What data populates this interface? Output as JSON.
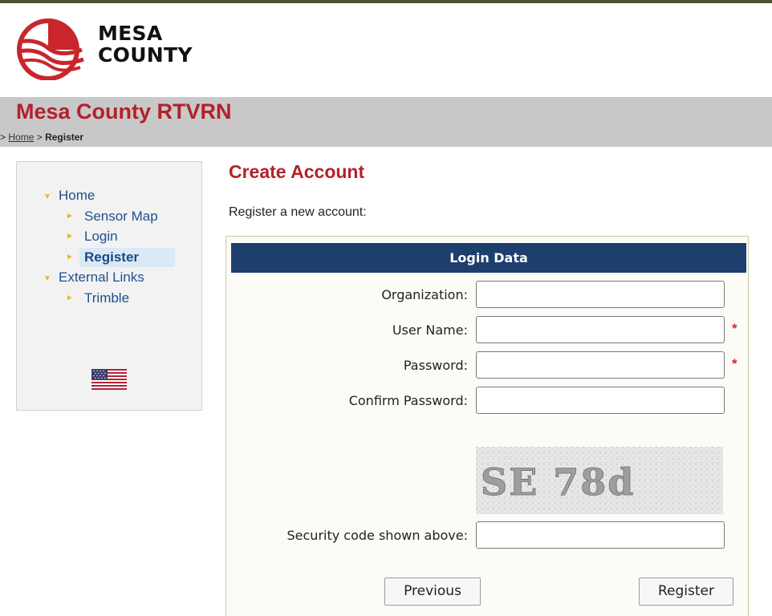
{
  "logo": {
    "line1": "MESA",
    "line2": "COUNTY"
  },
  "site_title": "Mesa County RTVRN",
  "breadcrumb": {
    "prefix": ">",
    "home": "Home",
    "separator": ">",
    "current": "Register"
  },
  "sidebar": {
    "items": [
      {
        "label": "Home"
      },
      {
        "label": "Sensor Map"
      },
      {
        "label": "Login"
      },
      {
        "label": "Register"
      },
      {
        "label": "External Links"
      },
      {
        "label": "Trimble"
      }
    ],
    "selected": "Register",
    "language_flag": "us-flag-icon"
  },
  "main": {
    "title": "Create Account",
    "intro": "Register a new account:"
  },
  "form": {
    "header": "Login Data",
    "fields": [
      {
        "label": "Organization:",
        "value": "",
        "required": false
      },
      {
        "label": "User Name:",
        "value": "",
        "required": true
      },
      {
        "label": "Password:",
        "value": "",
        "required": true
      },
      {
        "label": "Confirm Password:",
        "value": "",
        "required": false
      }
    ],
    "captcha_text": "SE 78d",
    "security_label": "Security code shown above:",
    "security_value": "",
    "required_marker": "*",
    "buttons": {
      "previous": "Previous",
      "register": "Register"
    }
  },
  "colors": {
    "title_red": "#b3212a",
    "nav_blue": "#1f4f8b",
    "header_navy": "#1e3f6e",
    "band_gray": "#c8c8c8",
    "required_red": "#d9262a"
  }
}
